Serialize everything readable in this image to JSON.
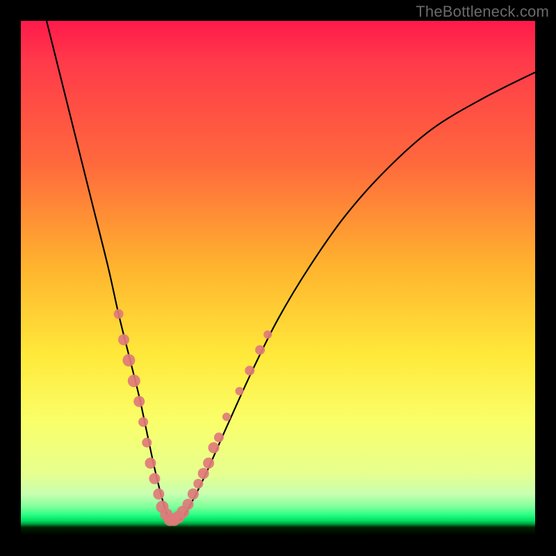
{
  "watermark": "TheBottleneck.com",
  "chart_data": {
    "type": "line",
    "title": "",
    "xlabel": "",
    "ylabel": "",
    "xlim": [
      0,
      100
    ],
    "ylim": [
      0,
      100
    ],
    "grid": false,
    "series": [
      {
        "name": "bottleneck-curve",
        "color": "#000000",
        "x": [
          5,
          8,
          11,
          14,
          17,
          19,
          21,
          23,
          24.5,
          26,
          27.5,
          29,
          31,
          33,
          36,
          40,
          45,
          50,
          56,
          63,
          71,
          80,
          90,
          100
        ],
        "y": [
          100,
          88,
          76,
          64,
          52,
          43,
          35,
          27,
          20,
          13,
          7,
          3,
          3,
          6,
          12,
          21,
          32,
          42,
          52,
          62,
          71,
          79,
          85,
          90
        ]
      }
    ],
    "markers": {
      "name": "highlight-dots",
      "color": "#e07a7a",
      "radius_small": 6,
      "radius_large": 9,
      "points": [
        {
          "x": 19.0,
          "y": 43,
          "r": 7
        },
        {
          "x": 20.0,
          "y": 38,
          "r": 8
        },
        {
          "x": 21.0,
          "y": 34,
          "r": 9
        },
        {
          "x": 22.0,
          "y": 30,
          "r": 9
        },
        {
          "x": 23.0,
          "y": 26,
          "r": 8
        },
        {
          "x": 23.8,
          "y": 22,
          "r": 7
        },
        {
          "x": 24.5,
          "y": 18,
          "r": 7
        },
        {
          "x": 25.2,
          "y": 14,
          "r": 8
        },
        {
          "x": 26.0,
          "y": 11,
          "r": 8
        },
        {
          "x": 26.8,
          "y": 8,
          "r": 8
        },
        {
          "x": 27.5,
          "y": 5.5,
          "r": 9
        },
        {
          "x": 28.3,
          "y": 4,
          "r": 9
        },
        {
          "x": 29.0,
          "y": 3,
          "r": 9
        },
        {
          "x": 29.8,
          "y": 3,
          "r": 9
        },
        {
          "x": 30.6,
          "y": 3.5,
          "r": 9
        },
        {
          "x": 31.5,
          "y": 4.5,
          "r": 9
        },
        {
          "x": 32.5,
          "y": 6,
          "r": 8
        },
        {
          "x": 33.5,
          "y": 8,
          "r": 8
        },
        {
          "x": 34.5,
          "y": 10,
          "r": 7
        },
        {
          "x": 35.5,
          "y": 12,
          "r": 8
        },
        {
          "x": 36.5,
          "y": 14,
          "r": 8
        },
        {
          "x": 37.5,
          "y": 17,
          "r": 8
        },
        {
          "x": 38.5,
          "y": 19,
          "r": 7
        },
        {
          "x": 40.0,
          "y": 23,
          "r": 6
        },
        {
          "x": 42.5,
          "y": 28,
          "r": 6
        },
        {
          "x": 44.5,
          "y": 32,
          "r": 7
        },
        {
          "x": 46.5,
          "y": 36,
          "r": 7
        },
        {
          "x": 48.0,
          "y": 39,
          "r": 6
        }
      ]
    }
  }
}
